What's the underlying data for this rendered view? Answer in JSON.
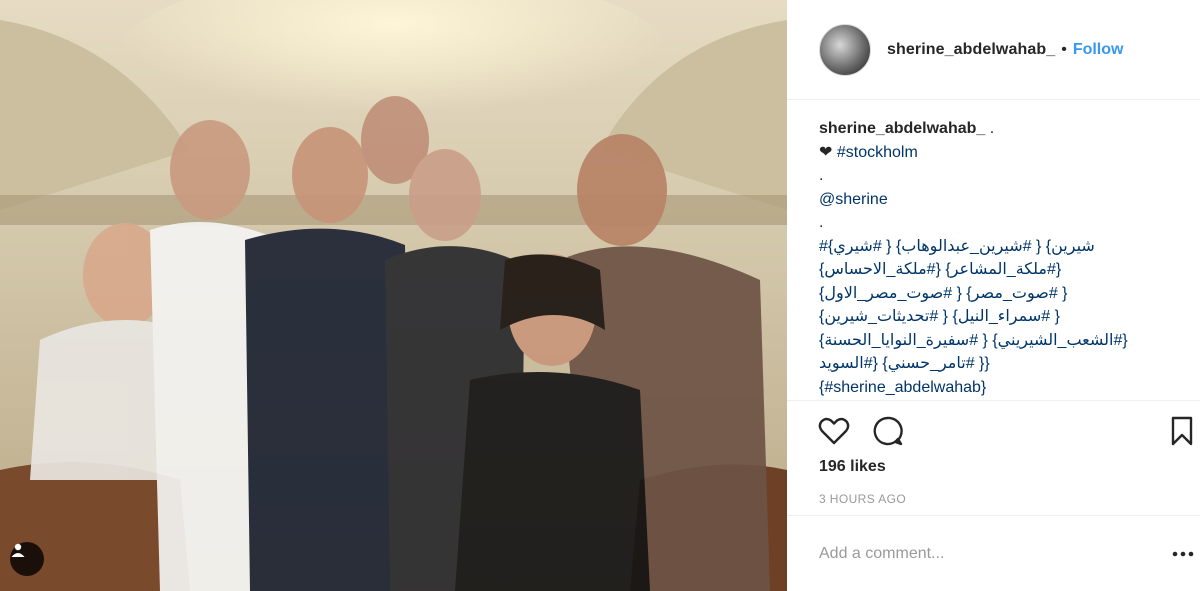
{
  "post": {
    "username": "sherine_abdelwahab_",
    "separator": "•",
    "follow_label": "Follow"
  },
  "caption": {
    "owner": "sherine_abdelwahab_",
    "owner_suffix": ".",
    "heart": "❤",
    "hashtag": "#stockholm",
    "dot1": ".",
    "mention": "@sherine",
    "dot2": ".",
    "lines": [
      "شيرين} { #شيرين_عبدالوهاب} { #شيري}#",
      "{#ملكة_المشاعر} {#ملكة_الاحساس}",
      "{ #صوت_مصر} { #صوت_مصر_الاول}",
      "{ #سمراء_النيل} { #تحديثات_شيرين}",
      "{#الشعب_الشيريني} { #سفيرة_النوايا_الحسنة}",
      "{{ #تامر_حسني} {#السويد",
      "{#sherine_abdelwahab}"
    ]
  },
  "likes": "196 likes",
  "timestamp": "3 HOURS AGO",
  "comment": {
    "placeholder": "Add a comment..."
  },
  "icons": {
    "like": "heart-outline-icon",
    "comment": "speech-bubble-icon",
    "save": "bookmark-icon",
    "more": "more-options-icon",
    "tag": "user-tag-icon"
  },
  "colors": {
    "link": "#3897f0",
    "hashtag": "#003569",
    "text": "#262626",
    "muted": "#999999",
    "border": "#efefef"
  }
}
